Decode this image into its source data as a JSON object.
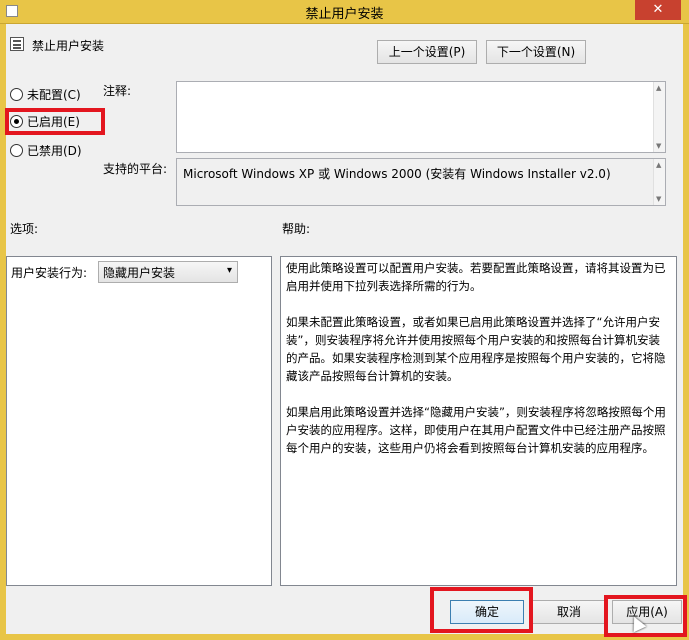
{
  "window": {
    "title": "禁止用户安装",
    "close_glyph": "✕"
  },
  "header": {
    "policy_name": "禁止用户安装",
    "prev_button": "上一个设置(P)",
    "next_button": "下一个设置(N)"
  },
  "state": {
    "options": [
      {
        "label": "未配置(C)",
        "selected": false
      },
      {
        "label": "已启用(E)",
        "selected": true
      },
      {
        "label": "已禁用(D)",
        "selected": false
      }
    ]
  },
  "comment": {
    "label": "注释:",
    "value": ""
  },
  "platform": {
    "label": "支持的平台:",
    "value": "Microsoft Windows XP 或 Windows 2000 (安装有 Windows Installer v2.0)"
  },
  "options_section": {
    "label": "选项:",
    "behavior_label": "用户安装行为:",
    "behavior_value": "隐藏用户安装"
  },
  "help_section": {
    "label": "帮助:",
    "paragraphs": [
      "使用此策略设置可以配置用户安装。若要配置此策略设置，请将其设置为已启用并使用下拉列表选择所需的行为。",
      "如果未配置此策略设置，或者如果已启用此策略设置并选择了“允许用户安装”，则安装程序将允许并使用按照每个用户安装的和按照每台计算机安装的产品。如果安装程序检测到某个应用程序是按照每个用户安装的，它将隐藏该产品按照每台计算机的安装。",
      "如果启用此策略设置并选择“隐藏用户安装”，则安装程序将忽略按照每个用户安装的应用程序。这样，即使用户在其用户配置文件中已经注册产品按照每个用户的安装，这些用户仍将会看到按照每台计算机安装的应用程序。"
    ]
  },
  "footer": {
    "ok_button": "确定",
    "cancel_button": "取消",
    "apply_button": "应用(A)"
  },
  "colors": {
    "titlebar": "#e8c547",
    "highlight": "#e3161f"
  }
}
